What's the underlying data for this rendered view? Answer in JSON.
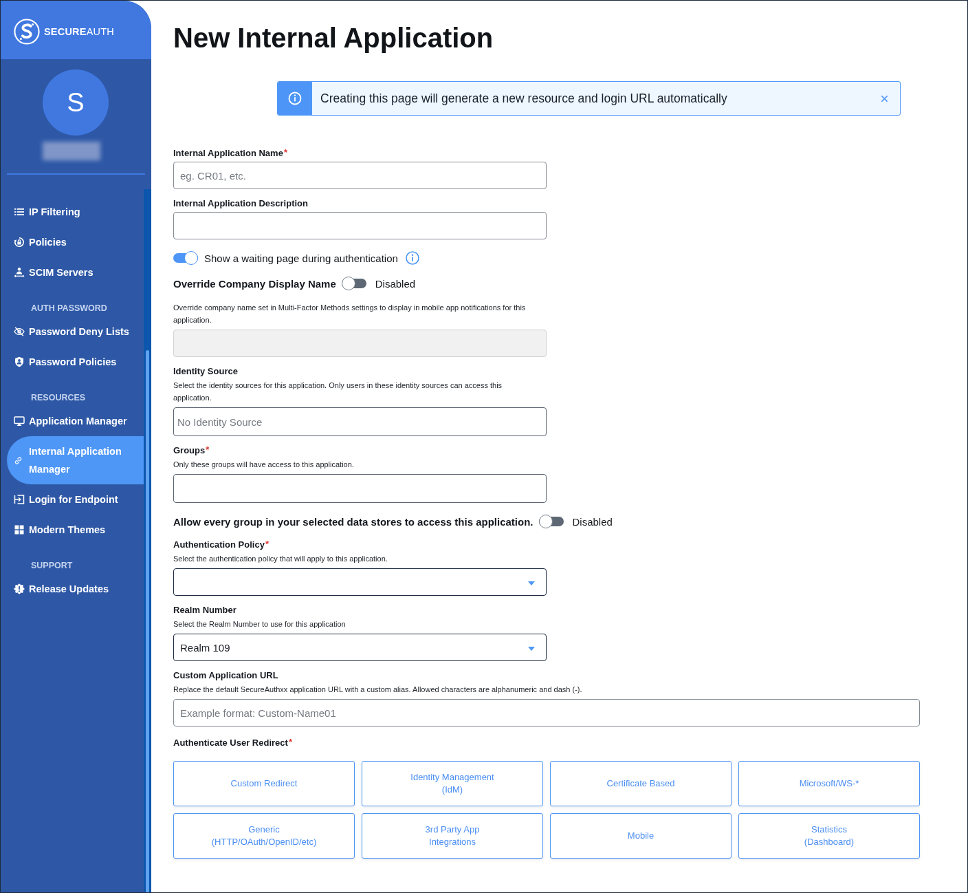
{
  "sidebar": {
    "logo": "**SECURE**AUTH",
    "avatar_initial": "S",
    "nav": [
      {
        "kind": "link",
        "label": "IP Filtering",
        "selected": false
      },
      {
        "kind": "link",
        "label": "Policies",
        "selected": false
      },
      {
        "kind": "link",
        "label": "SCIM Servers",
        "selected": false
      },
      {
        "kind": "heading",
        "label": "AUTH PASSWORD"
      },
      {
        "kind": "link",
        "label": "Password Deny Lists",
        "selected": false
      },
      {
        "kind": "link",
        "label": "Password Policies",
        "selected": false
      },
      {
        "kind": "heading",
        "label": "RESOURCES"
      },
      {
        "kind": "link",
        "label": "Application Manager",
        "selected": false
      },
      {
        "kind": "link",
        "label": "Internal Application Manager",
        "selected": true
      },
      {
        "kind": "link",
        "label": "Login for Endpoint",
        "selected": false
      },
      {
        "kind": "link",
        "label": "Modern Themes",
        "selected": false
      },
      {
        "kind": "heading",
        "label": "SUPPORT"
      },
      {
        "kind": "link",
        "label": "Release Updates",
        "selected": false
      }
    ]
  },
  "page": {
    "title": "New Internal Application"
  },
  "banner": {
    "text": "Creating this page will generate a new resource and login URL automatically"
  },
  "form": [
    {
      "kind": "input",
      "label": "Internal Application Name",
      "required_mark": "*",
      "placeholder": "eg. CR01, etc."
    },
    {
      "kind": "input",
      "label": "Internal Application Description"
    },
    {
      "kind": "toggle",
      "label": "Show a waiting page during authentication",
      "on": true,
      "info_icon": true
    },
    {
      "kind": "switch",
      "label": "Override Company Display Name",
      "on": false,
      "status": "Disabled"
    },
    {
      "kind": "input",
      "help": "Override company name set in Multi-Factor Methods settings to display in mobile app notifications for this application.",
      "disabled": true
    },
    {
      "kind": "input",
      "label": "Identity Source",
      "help": "Select the identity sources for this application. Only users in these identity sources can access this application.",
      "placeholder": "No Identity Source"
    },
    {
      "kind": "input",
      "label": "Groups",
      "required_mark": "*",
      "help": "Only these groups will have access to this application."
    },
    {
      "kind": "switch",
      "label": "Allow every group in your selected data stores to access this application.",
      "on": false,
      "status": "Disabled"
    },
    {
      "kind": "select",
      "label": "Authentication Policy",
      "required_mark": "*",
      "help": "Select the authentication policy that will apply to this application."
    },
    {
      "kind": "select",
      "label": "Realm Number",
      "help": "Select the Realm Number to use for this application",
      "value": "Realm 109"
    },
    {
      "kind": "url",
      "label": "Custom Application URL",
      "help": "Replace the default SecureAuthxx application URL with a custom alias. Allowed characters are alphanumeric and dash (-).",
      "placeholder": "Example format: Custom-Name01"
    },
    {
      "kind": "choices",
      "label": "Authenticate User Redirect",
      "required_mark": "*",
      "options": [
        "Custom Redirect",
        "Identity Management\n(IdM)",
        "Certificate Based",
        "Microsoft/WS-*",
        "Generic\n(HTTP/OAuth/OpenID/etc)",
        "3rd Party App\nIntegrations",
        "Mobile",
        "Statistics\n(Dashboard)"
      ]
    }
  ]
}
